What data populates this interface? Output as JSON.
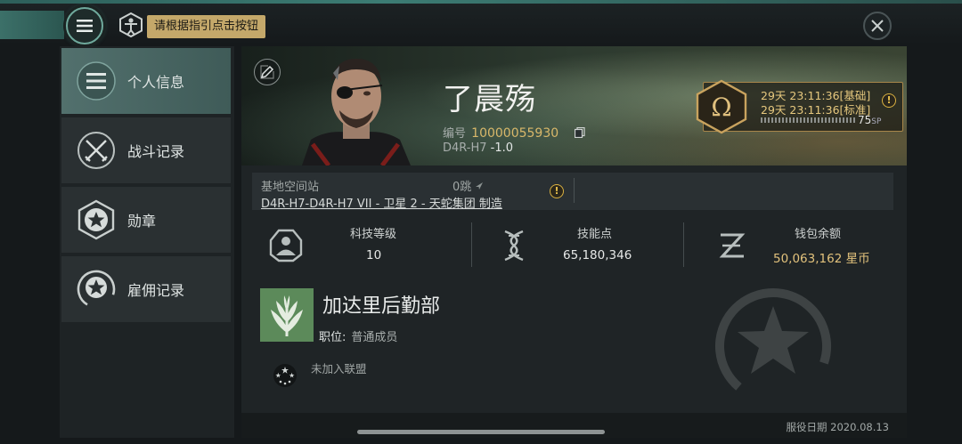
{
  "header": {
    "tooltip": "请根据指引点击按钮"
  },
  "sidebar": {
    "items": [
      {
        "label": "个人信息",
        "icon": "menu-lines-icon",
        "active": true
      },
      {
        "label": "战斗记录",
        "icon": "crossed-swords-icon",
        "active": false
      },
      {
        "label": "勋章",
        "icon": "star-medal-icon",
        "active": false
      },
      {
        "label": "雇佣记录",
        "icon": "star-wreath-icon",
        "active": false
      }
    ]
  },
  "profile": {
    "name": "了晨殇",
    "id_label": "编号",
    "id_value": "10000055930",
    "security_system": "D4R-H7",
    "security_value": "-1.0"
  },
  "omega": {
    "line1": "29天 23:11:36[基础]",
    "line2": "29天 23:11:36[标准]",
    "sp_value": "75",
    "sp_unit": "SP"
  },
  "location": {
    "label": "基地空间站",
    "jumps": "0跳",
    "station": "D4R-H7-D4R-H7 VII - 卫星 2 - 天蛇集团 制造"
  },
  "stats": {
    "tech_label": "科技等级",
    "tech_value": "10",
    "skill_label": "技能点",
    "skill_value": "65,180,346",
    "wallet_label": "钱包余额",
    "wallet_value": "50,063,162 星币"
  },
  "corporation": {
    "name": "加达里后勤部",
    "role_label": "职位:",
    "role_value": "普通成员",
    "alliance": "未加入联盟"
  },
  "footer": {
    "service_date": "服役日期 2020.08.13"
  },
  "colors": {
    "accent_teal": "#6fa99c",
    "gold": "#d9b86a",
    "corp_green": "#5c8a5a"
  }
}
